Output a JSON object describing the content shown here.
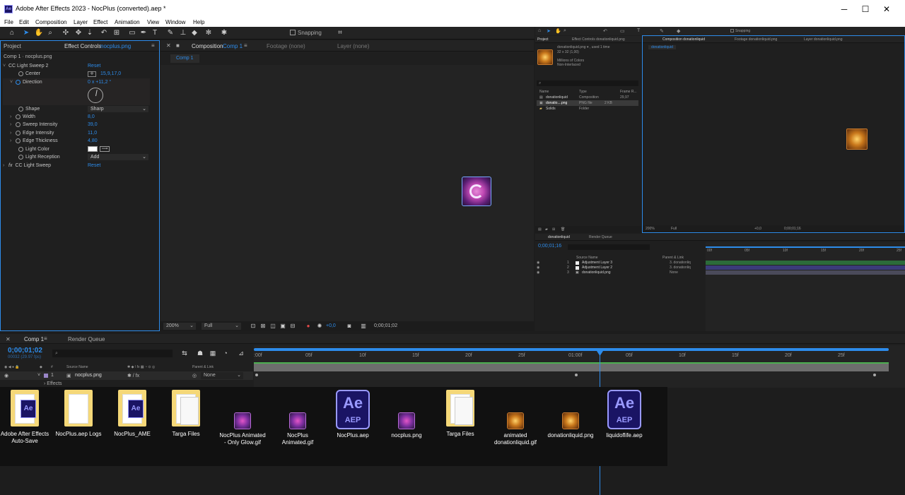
{
  "app": {
    "title": "Adobe After Effects 2023 - NocPlus (converted).aep *",
    "logo": "Ae"
  },
  "window_controls": {
    "minimize": "─",
    "maximize": "☐",
    "close": "✕"
  },
  "menu": [
    "File",
    "Edit",
    "Composition",
    "Layer",
    "Effect",
    "Animation",
    "View",
    "Window",
    "Help"
  ],
  "toolbar": {
    "snapping_label": "Snapping"
  },
  "left_panel": {
    "tabs": {
      "project": "Project",
      "effect_controls": "Effect Controls",
      "effect_controls_target": "nocplus.png"
    },
    "layer_path": "Comp 1 · nocplus.png",
    "effects": [
      {
        "name": "CC Light Sweep 2",
        "reset": "Reset"
      }
    ],
    "params": [
      {
        "name": "Center",
        "value": "15,9,17,0"
      },
      {
        "name": "Direction",
        "value": "0 x +11,2 °"
      },
      {
        "name": "Shape",
        "value": "Sharp"
      },
      {
        "name": "Width",
        "value": "8,0"
      },
      {
        "name": "Sweep Intensity",
        "value": "39,0"
      },
      {
        "name": "Edge Intensity",
        "value": "11,0"
      },
      {
        "name": "Edge Thickness",
        "value": "4,80"
      },
      {
        "name": "Light Color",
        "value": ""
      },
      {
        "name": "Light Reception",
        "value": "Add"
      }
    ],
    "effect2": {
      "name": "CC Light Sweep",
      "reset": "Reset",
      "fx": "fx"
    }
  },
  "composition_panel": {
    "tab_label": "Composition",
    "tab_comp": "Comp 1",
    "footage_tab": "Footage (none)",
    "layer_tab": "Layer (none)",
    "comp_chip": "Comp 1",
    "zoom": "200%",
    "resolution": "Full",
    "exposure": "+0,0",
    "timecode": "0;00;01;02"
  },
  "timeline": {
    "tab_comp": "Comp 1",
    "tab_render": "Render Queue",
    "timecode": "0;00;01;02",
    "fps": "00032 (29.97 fps)",
    "cols": {
      "source_name": "Source Name",
      "parent": "Parent & Link"
    },
    "layer": {
      "num": "1",
      "name": "nocplus.png",
      "parent": "None"
    },
    "effects_row": "Effects",
    "ruler": [
      ":00f",
      "05f",
      "10f",
      "15f",
      "20f",
      "25f",
      "01:00f",
      "05f",
      "10f",
      "15f",
      "20f",
      "25f"
    ],
    "playhead_progress": 0.545
  },
  "right_project": {
    "tabs": {
      "project": "Project",
      "effect_controls": "Effect Controls donationliquid.png"
    },
    "info_name": "donationliquid.png ▾ , used 1 time",
    "info_dims": "32 x 32 (1,00)",
    "info_colors": "Millions of Colors",
    "info_interlace": "Non-Interlaced",
    "cols": [
      "Name",
      "Type",
      "Frame R..."
    ],
    "items": [
      {
        "name": "donationliquid",
        "type": "Composition",
        "rate": "29,97"
      },
      {
        "name": "donatio....png",
        "type": "PNG file",
        "size": "2 KB"
      },
      {
        "name": "Solids",
        "type": "Folder"
      }
    ]
  },
  "right_comp": {
    "tab": "Composition donationliquid",
    "footage_tab": "Footage donationliquid.png",
    "layer_tab": "Layer donationliquid.png",
    "chip": "donationliquid",
    "zoom": "200%",
    "resolution": "Full",
    "exposure": "+0,0",
    "timecode": "0;00;01;16"
  },
  "right_timeline": {
    "tab": "donationliquid",
    "render_tab": "Render Queue",
    "timecode": "0;00;01;16",
    "cols": {
      "source_name": "Source Name",
      "parent": "Parent & Link"
    },
    "layers": [
      {
        "num": "1",
        "name": "Adjustment Layer 3",
        "parent": "3. donationliq"
      },
      {
        "num": "2",
        "name": "Adjustment Layer 2",
        "parent": "3. donationliq"
      },
      {
        "num": "3",
        "name": "donationliquid.png",
        "parent": "None"
      }
    ],
    "ruler": [
      "00f",
      "05f",
      "10f",
      "15f",
      "20f",
      "25f"
    ]
  },
  "files": [
    {
      "label": "Adobe After Effects Auto-Save",
      "kind": "folder-ae",
      "icon": "folder-icon"
    },
    {
      "label": "NocPlus.aep Logs",
      "kind": "folder",
      "icon": "folder-icon"
    },
    {
      "label": "NocPlus_AME",
      "kind": "folder-ae",
      "icon": "folder-icon"
    },
    {
      "label": "Targa Files",
      "kind": "folder-targa",
      "icon": "folder-icon"
    },
    {
      "label": "NocPlus Animated - Only Glow.gif",
      "kind": "img-noc",
      "icon": "gif-icon"
    },
    {
      "label": "NocPlus Animated.gif",
      "kind": "img-noc",
      "icon": "gif-icon"
    },
    {
      "label": "NocPlus.aep",
      "kind": "aep",
      "icon": "aep-icon"
    },
    {
      "label": "nocplus.png",
      "kind": "img-noc",
      "icon": "png-icon"
    },
    {
      "label": "Targa Files",
      "kind": "folder-targa",
      "icon": "folder-icon"
    },
    {
      "label": "animated donationliquid.gif",
      "kind": "img-don",
      "icon": "gif-icon"
    },
    {
      "label": "donationliquid.png",
      "kind": "img-don",
      "icon": "png-icon"
    },
    {
      "label": "liquidoflife.aep",
      "kind": "aep",
      "icon": "aep-icon"
    }
  ],
  "colors": {
    "accent": "#2d8ceb",
    "panel": "#1f1f1f",
    "ae_purple": "#9999ff",
    "ae_bg": "#1a1464"
  }
}
